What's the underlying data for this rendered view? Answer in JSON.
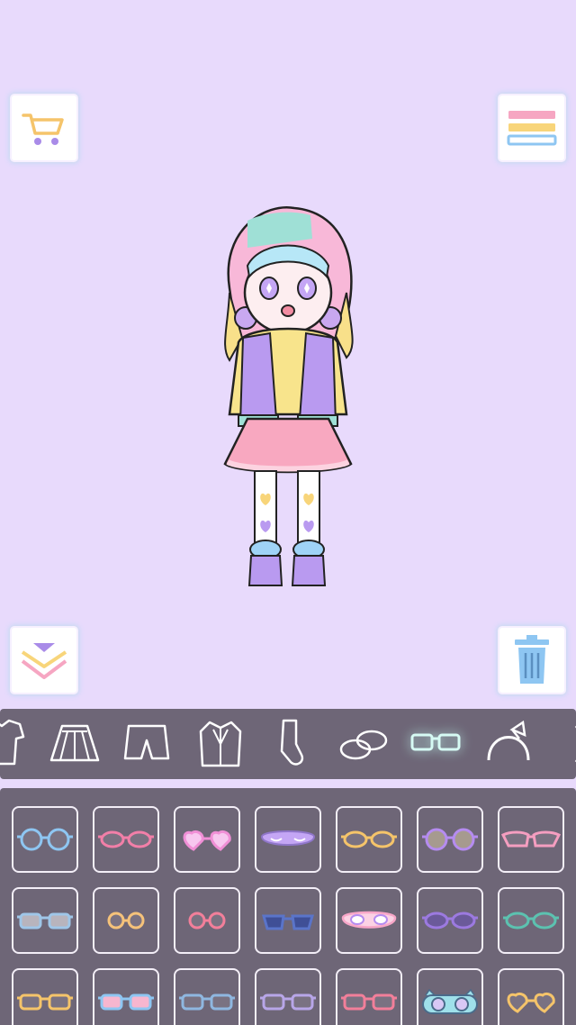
{
  "screen": {
    "background": "#e8dafc",
    "panel_color": "#6e6677"
  },
  "toolbar": {
    "shop_icon": "cart-icon",
    "menu_icon": "menu-stripes-icon",
    "hide_icon": "chevron-down-icon",
    "trash_icon": "trash-icon"
  },
  "character": {
    "name": "doll-avatar",
    "outfit": [
      "rainbow-pastel-hair",
      "purple-varsity-jacket",
      "pink-heart-skirt",
      "heart-stockings",
      "purple-fluffy-boots"
    ]
  },
  "categories": [
    {
      "id": "shirt",
      "icon": "shirt-icon",
      "selected": false
    },
    {
      "id": "skirt",
      "icon": "skirt-icon",
      "selected": false
    },
    {
      "id": "shorts",
      "icon": "shorts-icon",
      "selected": false
    },
    {
      "id": "outerwear",
      "icon": "jacket-icon",
      "selected": false
    },
    {
      "id": "socks",
      "icon": "socks-icon",
      "selected": false
    },
    {
      "id": "shoes",
      "icon": "shoes-icon",
      "selected": false
    },
    {
      "id": "glasses",
      "icon": "glasses-icon",
      "selected": true
    },
    {
      "id": "headband",
      "icon": "headband-icon",
      "selected": false
    },
    {
      "id": "more",
      "icon": "partial-icon",
      "selected": false
    }
  ],
  "glasses_items": [
    {
      "style": "round",
      "frame": "#8ec6f2",
      "lens": "#7a7282"
    },
    {
      "style": "oval",
      "frame": "#f27fa8",
      "lens": "#7a7282"
    },
    {
      "style": "heart",
      "frame": "#f08fd6",
      "lens": "#f7c7ef"
    },
    {
      "style": "sleep-mask",
      "frame": "#c4a6f5",
      "lens": "#c4a6f5"
    },
    {
      "style": "oval",
      "frame": "#f5c46a",
      "lens": "#7a7282"
    },
    {
      "style": "round",
      "frame": "#b58cf0",
      "lens": "#a69a8f"
    },
    {
      "style": "cat-eye",
      "frame": "#f59ec0",
      "lens": "#7a7282"
    },
    {
      "style": "rect",
      "frame": "#9fc6e8",
      "lens": "#b8b4bd"
    },
    {
      "style": "round-small",
      "frame": "#f5c27a",
      "lens": "#7a7282"
    },
    {
      "style": "round-small",
      "frame": "#f27f9a",
      "lens": "#7a7282"
    },
    {
      "style": "sunglasses",
      "frame": "#5a74c9",
      "lens": "#3f4f96"
    },
    {
      "style": "eye-mask",
      "frame": "#f7a6c8",
      "lens": "#fbd2e4"
    },
    {
      "style": "oval",
      "frame": "#9c7ae0",
      "lens": "#6b5a9a"
    },
    {
      "style": "oval",
      "frame": "#5cc2b0",
      "lens": "#7a7282"
    },
    {
      "style": "rect",
      "frame": "#f5c46a",
      "lens": "#7a7282"
    },
    {
      "style": "rect",
      "frame": "#8ec6f2",
      "lens": "#f7b6cf"
    },
    {
      "style": "rect",
      "frame": "#8fb7e0",
      "lens": "#7a7282"
    },
    {
      "style": "rect",
      "frame": "#b8a6e8",
      "lens": "#7a7282"
    },
    {
      "style": "rect",
      "frame": "#f27f9a",
      "lens": "#7a7282"
    },
    {
      "style": "goggles",
      "frame": "#9fe0ea",
      "lens": "#d8c8f5"
    },
    {
      "style": "heart",
      "frame": "#f5c46a",
      "lens": "#7a7282"
    }
  ]
}
